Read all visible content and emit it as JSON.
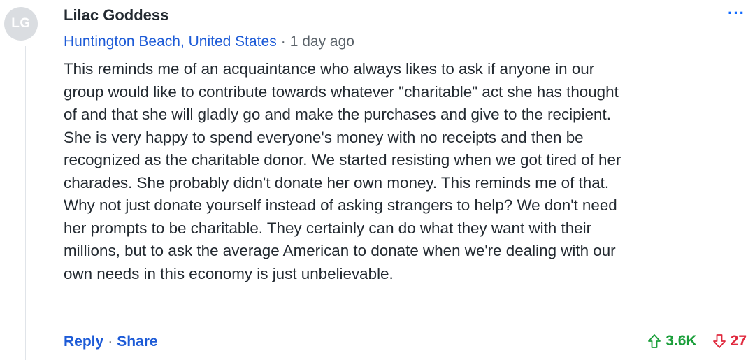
{
  "comment": {
    "avatar_initials": "LG",
    "author": "Lilac Goddess",
    "more_label": "···",
    "location": "Huntington Beach, United States",
    "separator": "·",
    "time_ago": "1 day ago",
    "body_lines": [
      "This reminds me of an acquaintance who always likes to ask if anyone in our",
      "group would like to contribute towards whatever \"charitable\" act she has thought",
      "of and that she will gladly go and make the purchases and give to the recipient.",
      "She is very happy to spend everyone's money with no receipts and then be",
      "recognized as the charitable donor. We started resisting when we got tired of her",
      "charades. She probably didn't donate her own money. This reminds me of that.",
      "Why not just donate yourself instead of asking strangers to help? We don't need",
      "her prompts to be charitable. They certainly can do what they want with their",
      "millions, but to ask the average American to donate when we're dealing with our",
      "own needs in this economy is just unbelievable."
    ],
    "actions": {
      "reply_label": "Reply",
      "separator": "·",
      "share_label": "Share"
    },
    "votes": {
      "upvotes": "3.6K",
      "downvotes": "27"
    }
  },
  "colors": {
    "link_blue": "#1d5bd7",
    "upvote_green": "#1a9e3a",
    "downvote_red": "#e0283d",
    "avatar_bg": "#dadde1"
  },
  "icons": {
    "upvote": "arrow-up-outline-icon",
    "downvote": "arrow-down-outline-icon",
    "more": "ellipsis-icon"
  }
}
